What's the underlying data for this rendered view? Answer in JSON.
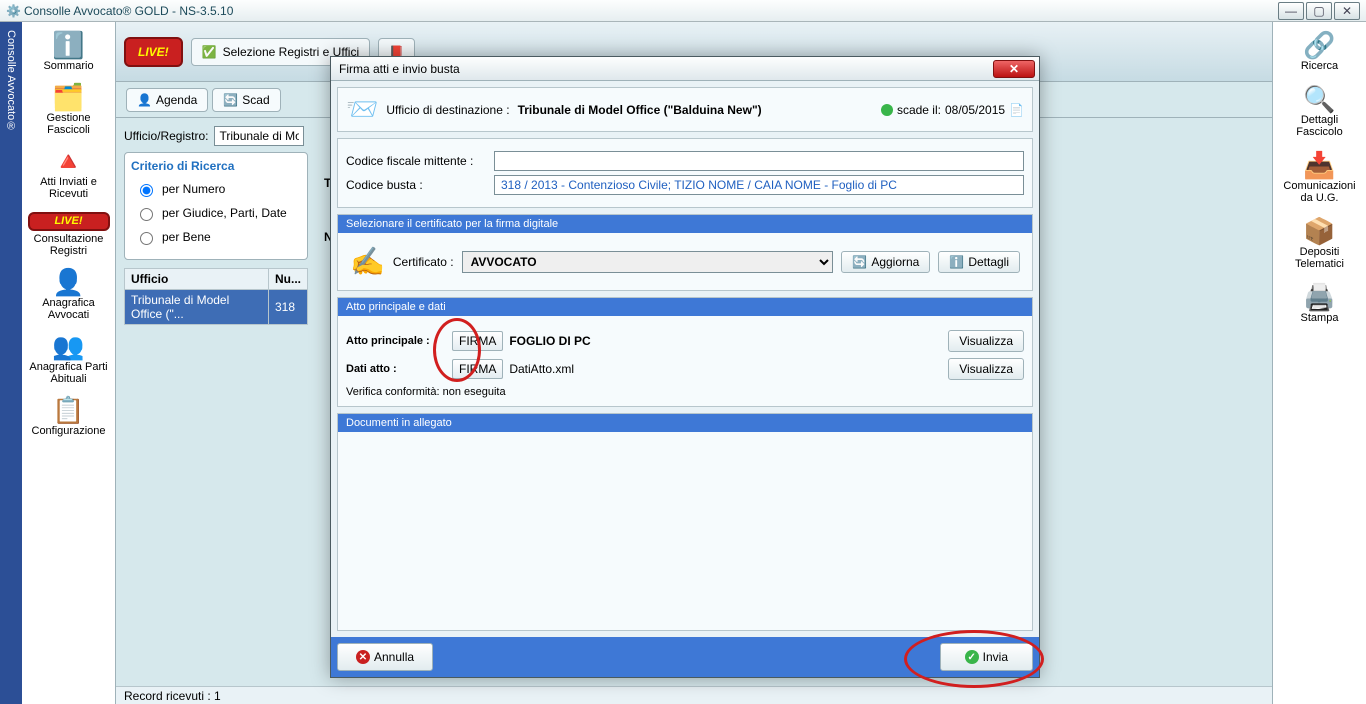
{
  "window": {
    "title": "Consolle Avvocato® GOLD - NS-3.5.10",
    "brand_strip": "Consolle Avvocato®"
  },
  "left_nav": [
    {
      "icon": "ℹ️",
      "label": "Sommario"
    },
    {
      "icon": "🗂️",
      "label": "Gestione Fascicoli"
    },
    {
      "icon": "🔺",
      "label": "Atti Inviati e Ricevuti"
    },
    {
      "icon": "LIVE!",
      "label": "Consultazione Registri"
    },
    {
      "icon": "👤",
      "label": "Anagrafica Avvocati"
    },
    {
      "icon": "👥",
      "label": "Anagrafica Parti Abituali"
    },
    {
      "icon": "📋",
      "label": "Configurazione"
    }
  ],
  "right_nav": [
    {
      "icon": "🔗",
      "label": "Ricerca"
    },
    {
      "icon": "🔍",
      "label": "Dettagli Fascicolo"
    },
    {
      "icon": "📥",
      "label": "Comunicazioni da U.G."
    },
    {
      "icon": "📦",
      "label": "Depositi Telematici"
    },
    {
      "icon": "🖨️",
      "label": "Stampa"
    }
  ],
  "topbar": {
    "live": "LIVE!",
    "tab1": "Selezione Registri e Uffici"
  },
  "toolbar2": {
    "agenda": "Agenda",
    "scad": "Scad"
  },
  "filters": {
    "ufficio_label": "Ufficio/Registro:",
    "ufficio_value": "Tribunale di Mo",
    "criterio_legend": "Criterio di Ricerca",
    "opt1": "per Numero",
    "opt2": "per Giudice, Parti, Date",
    "opt3": "per Bene",
    "tipologia": "Tipologia N",
    "numero": "Numero:"
  },
  "grid": {
    "col1": "Ufficio",
    "col2": "Nu...",
    "row_ufficio": "Tribunale di Model Office (\"...",
    "row_num": "318"
  },
  "status": "Record ricevuti : 1",
  "modal": {
    "title": "Firma atti e invio busta",
    "dest_label": "Ufficio di destinazione :",
    "dest_value": "Tribunale di Model Office (\"Balduina New\")",
    "expiry_label": "scade il:",
    "expiry_value": "08/05/2015",
    "cf_label": "Codice fiscale mittente :",
    "cf_value": "",
    "cb_label": "Codice  busta :",
    "cb_value": "318 / 2013 - Contenzioso Civile; TIZIO NOME / CAIA NOME - Foglio di PC",
    "cert_header": "Selezionare il certificato per la firma digitale",
    "cert_label": "Certificato :",
    "cert_value": "AVVOCATO",
    "aggiorna": "Aggiorna",
    "dettagli": "Dettagli",
    "atto_header": "Atto principale e dati",
    "atto_label": "Atto principale :",
    "firma": "FIRMA",
    "atto_file": "FOGLIO DI PC",
    "dati_label": "Dati atto :",
    "dati_file": "DatiAtto.xml",
    "visualizza": "Visualizza",
    "verifica": "Verifica conformità: non eseguita",
    "alleg_header": "Documenti in allegato",
    "annulla": "Annulla",
    "invia": "Invia"
  }
}
